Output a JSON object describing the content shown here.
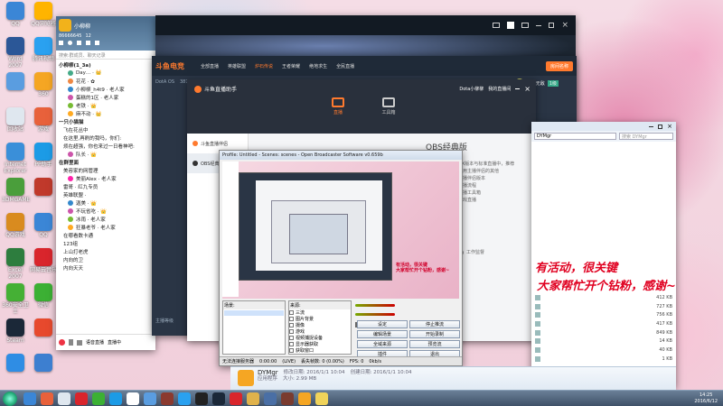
{
  "desktop": {
    "icons": [
      {
        "label": "QQ",
        "color": "#3b86d6"
      },
      {
        "label": "QQ浏览器",
        "color": "#ffb400"
      },
      {
        "label": "Word 2007",
        "color": "#2b5797"
      },
      {
        "label": "腾讯视频",
        "color": "#2aa1f0"
      },
      {
        "label": "",
        "color": "#5a9de0"
      },
      {
        "label": "360",
        "color": "#f5a623"
      },
      {
        "label": "回收站",
        "color": "#dfe7ef"
      },
      {
        "label": "游戏",
        "color": "#e8613b"
      },
      {
        "label": "Internet Explorer",
        "color": "#3a8fd9"
      },
      {
        "label": "PP助手",
        "color": "#1c9be6"
      },
      {
        "label": "3DMGAME",
        "color": "#4a9e3b"
      },
      {
        "label": "",
        "color": "#c0392b"
      },
      {
        "label": "QQ游戏",
        "color": "#d98b1f"
      },
      {
        "label": "QQ",
        "color": "#3b86d6"
      },
      {
        "label": "Excel 2007",
        "color": "#2d7d3e"
      },
      {
        "label": "网易云音乐",
        "color": "#d9252c"
      },
      {
        "label": "360安全卫士",
        "color": "#45b035"
      },
      {
        "label": "微信",
        "color": "#3cb034"
      },
      {
        "label": "Steam",
        "color": "#1b2838"
      },
      {
        "label": "",
        "color": "#e7492d"
      },
      {
        "label": "",
        "color": "#2f8de4"
      },
      {
        "label": "",
        "color": "#3d7fd0"
      }
    ]
  },
  "qq": {
    "title": "小柳柳",
    "id": "86666645",
    "level": "12",
    "search_placeholder": "搜索:群成员、聊天记录",
    "items": [
      {
        "text": "小柳柳(1_3a)",
        "indent": 0
      },
      {
        "text": "Day… · 👑",
        "indent": 2
      },
      {
        "text": "花花 · ✿",
        "indent": 2
      },
      {
        "text": "小柳柳_h4t9 · 老人家",
        "indent": 2
      },
      {
        "text": "蛋糕的1区 · 老人家",
        "indent": 2
      },
      {
        "text": "老铁 · 👑",
        "indent": 2
      },
      {
        "text": "麻不动 · 👑",
        "indent": 2
      },
      {
        "text": "一只小猫猫",
        "indent": 0
      },
      {
        "text": "飞在花丛中",
        "indent": 1
      },
      {
        "text": "在这里,再刷的我吗，你们:",
        "indent": 1
      },
      {
        "text": "烦在超强，你也来过一日看神吧:",
        "indent": 1
      },
      {
        "text": "队长 · 👑",
        "indent": 2
      },
      {
        "text": "在群里面",
        "indent": 0
      },
      {
        "text": "美容家的网管理",
        "indent": 1
      },
      {
        "text": "美丽Alex · 老人家",
        "indent": 2
      },
      {
        "text": "雷哥 · 红九专员",
        "indent": 1
      },
      {
        "text": "英雄联盟 ·",
        "indent": 1
      },
      {
        "text": "迦美 · 👑",
        "indent": 2
      },
      {
        "text": "不玩省吃 · 👑",
        "indent": 2
      },
      {
        "text": "冰雨 · 老人家",
        "indent": 2
      },
      {
        "text": "狂暴老爷 · 老人家",
        "indent": 2
      },
      {
        "text": "在哪看数卡通",
        "indent": 1
      },
      {
        "text": "123组",
        "indent": 1
      },
      {
        "text": "上山打老虎",
        "indent": 1
      },
      {
        "text": "内向的卫",
        "indent": 1
      },
      {
        "text": "内向天天",
        "indent": 1
      }
    ],
    "bottom_label": "语音直播",
    "bottom_label2": "直播中"
  },
  "game": {
    "tabs": [
      "游戏中心",
      "英雄联盟",
      "斗鱼TV",
      "斗鱼直播"
    ],
    "active_tab": "斗鱼直播"
  },
  "douyu": {
    "logo": "斗鱼电竞",
    "nav": [
      "全部直播",
      "英雄联盟",
      "炉石传说",
      "王者荣耀",
      "绝地求生",
      "全民直播"
    ],
    "active_nav": "炉石传说",
    "right_btn": "房间名称",
    "user": "天下无敌",
    "user_lvl": "1级",
    "dota": "DotA OS",
    "id": "387112",
    "host_level": "主播等级"
  },
  "assistant": {
    "title": "斗鱼直播助手",
    "user": "Dota小柳柳",
    "user_action": "我的直播间",
    "tabs": [
      "直播",
      "工具箱"
    ],
    "side": [
      "斗鱼直播伴侣",
      "OBS经典版"
    ],
    "side_active": "OBS经典版",
    "panel_title": "OBS经典版",
    "panel_lines": [
      "DX版本与标准直播中，推荐",
      "使用主播伴侣的其他",
      "主播伴侣版本",
      "直播流程",
      "直播工具箱",
      "游戏直播"
    ],
    "start_btn": "开始直播",
    "checkbox": "工作监督"
  },
  "obs": {
    "title": "Profile: Untitled - Scenes: scenes - Open Broadcaster Software v0.659b",
    "scene_header": "场景:",
    "source_header": "来源:",
    "sources": [
      "三流",
      "图片背景",
      "摄像",
      "游戏",
      "视频捕捉设备",
      "显示器获取",
      "获取窗口"
    ],
    "buttons": [
      "设定",
      "停止推流",
      "编辑场景",
      "开始录制",
      "全域来源",
      "预览流",
      "插件",
      "退出"
    ],
    "status": {
      "state": "无法连接服务器",
      "time": "0:00:00",
      "bitrate": "(LIVE)",
      "dropped": "丢失帧数: 0 (0.00%)",
      "fps": "FPS: 0",
      "kbps": "0kb/s"
    }
  },
  "stream_text": {
    "line1": "有活动，很关键",
    "line2": "大家帮忙开个钻粉，感谢~"
  },
  "explorer": {
    "path": "DYMgr",
    "search_placeholder": "搜索 DYMgr",
    "files": [
      {
        "size": "412 KB"
      },
      {
        "size": "727 KB"
      },
      {
        "size": "756 KB"
      },
      {
        "size": "417 KB"
      },
      {
        "size": "849 KB"
      },
      {
        "size": "14 KB"
      },
      {
        "size": "40 KB"
      },
      {
        "size": "1 KB"
      }
    ],
    "detail": {
      "name": "DYMgr",
      "modified_label": "修改日期: 2016/1/1 10:04",
      "created_label": "创建日期: 2016/1/1 10:04",
      "type": "应用程序",
      "size": "大小: 2.99 MB"
    }
  },
  "taskbar": {
    "time": "14:25",
    "date": "2016/6/12",
    "items": [
      {
        "color": "#3b86d6"
      },
      {
        "color": "#e8613b"
      },
      {
        "color": "#dfe7ef"
      },
      {
        "color": "#d9252c"
      },
      {
        "color": "#3cb034"
      },
      {
        "color": "#1c9be6"
      },
      {
        "color": "#ffffff"
      },
      {
        "color": "#5a9de0"
      },
      {
        "color": "#8b3a2f"
      },
      {
        "color": "#2aa1f0"
      },
      {
        "color": "#222222"
      },
      {
        "color": "#1b2838"
      },
      {
        "color": "#d9252c"
      },
      {
        "color": "#e0b24b"
      },
      {
        "color": "#4a6fa5"
      },
      {
        "color": "#7a3b2f"
      },
      {
        "color": "#f5a623"
      },
      {
        "color": "#f0d35a"
      }
    ]
  }
}
